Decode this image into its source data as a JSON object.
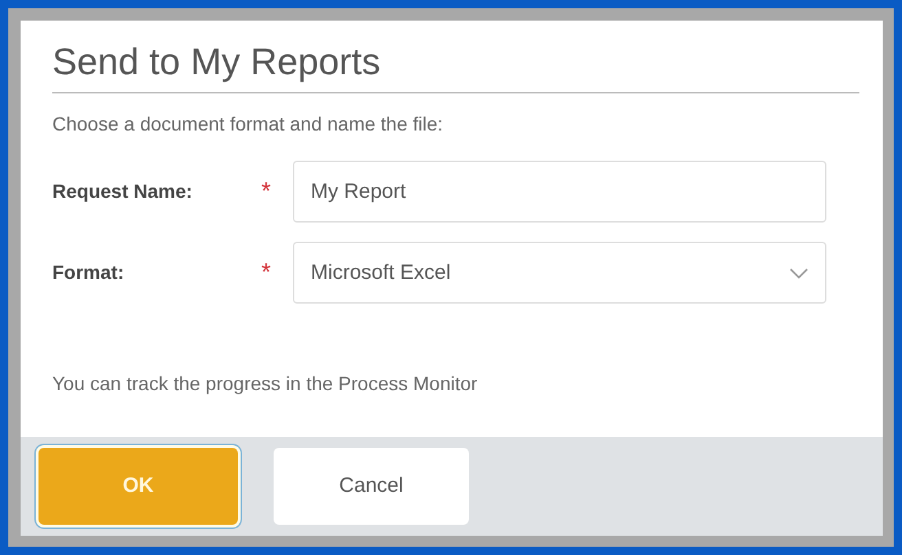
{
  "dialog": {
    "title": "Send to My Reports",
    "instructions": "Choose a document format and name the file:",
    "fields": [
      {
        "kind": "text",
        "label": "Request Name:",
        "required_mark": "*",
        "value": "My Report"
      },
      {
        "kind": "select",
        "label": "Format:",
        "required_mark": "*",
        "value": "Microsoft Excel"
      }
    ],
    "note": "You can track the progress in the Process Monitor",
    "buttons": [
      {
        "kind": "primary",
        "label": "OK",
        "focused": true
      },
      {
        "kind": "secondary",
        "label": "Cancel",
        "focused": false
      }
    ]
  }
}
